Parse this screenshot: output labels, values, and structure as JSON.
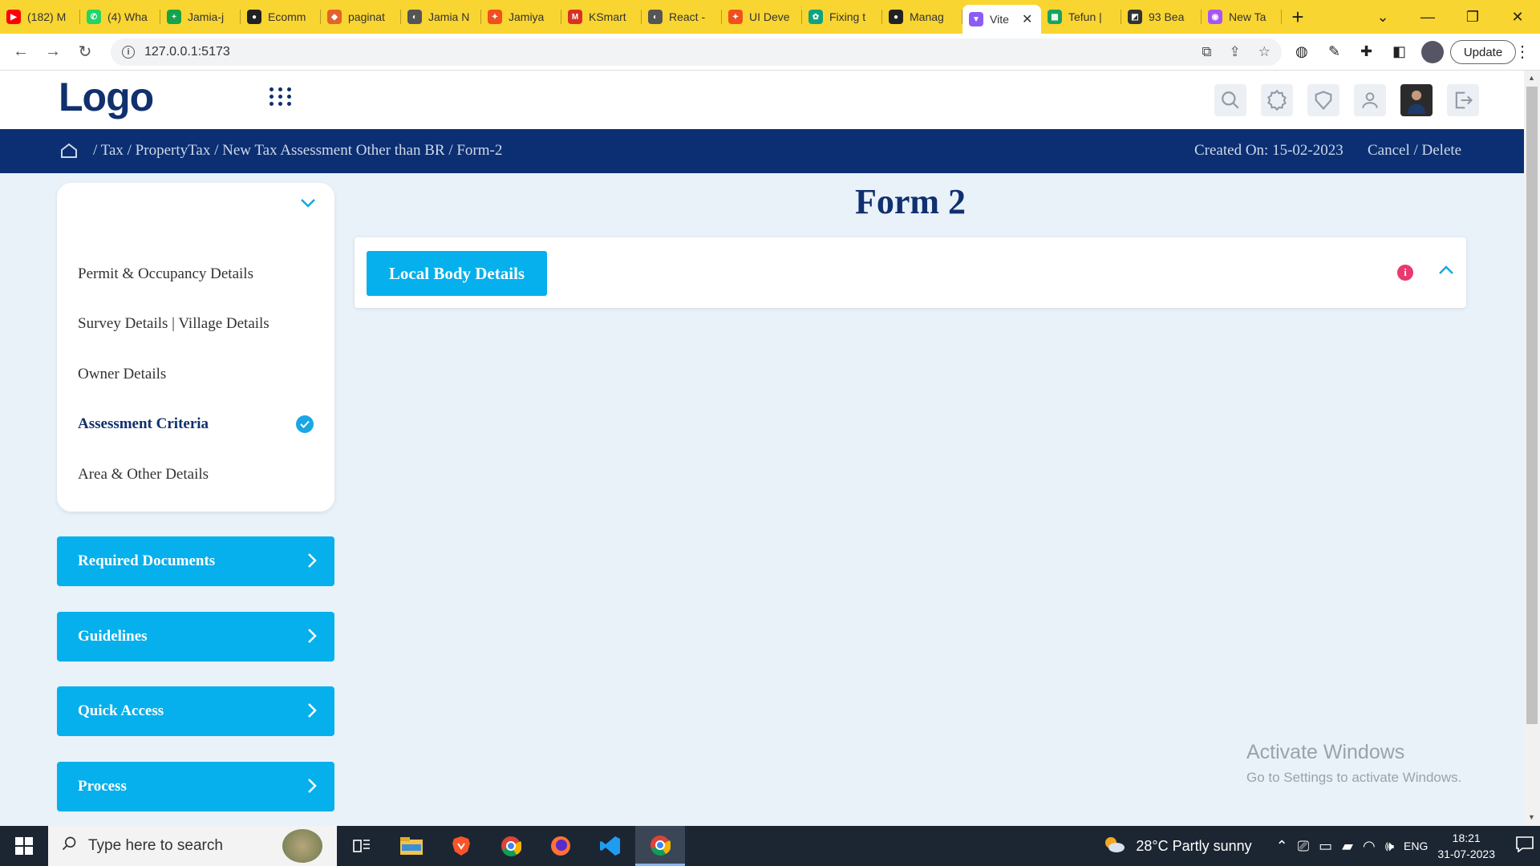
{
  "browser": {
    "tabs": [
      {
        "label": "(182) M",
        "color": "#ff0000",
        "glyph": "▶"
      },
      {
        "label": "(4) Wha",
        "color": "#25d366",
        "glyph": "✆"
      },
      {
        "label": "Jamia-j",
        "color": "#16a34a",
        "glyph": "+"
      },
      {
        "label": "Ecomm",
        "color": "#222222",
        "glyph": "●"
      },
      {
        "label": "paginat",
        "color": "#e2632d",
        "glyph": "◆"
      },
      {
        "label": "Jamia N",
        "color": "#555555",
        "glyph": "◐"
      },
      {
        "label": "Jamiya",
        "color": "#f24e1e",
        "glyph": "✦"
      },
      {
        "label": "KSmart",
        "color": "#d93025",
        "glyph": "M"
      },
      {
        "label": "React -",
        "color": "#555555",
        "glyph": "◐"
      },
      {
        "label": "UI Deve",
        "color": "#f24e1e",
        "glyph": "✦"
      },
      {
        "label": "Fixing t",
        "color": "#10a37f",
        "glyph": "✿"
      },
      {
        "label": "Manag",
        "color": "#222222",
        "glyph": "●"
      },
      {
        "label": "Vite",
        "color": "#8b5cf6",
        "glyph": "▼",
        "active": true
      },
      {
        "label": "Tefun |",
        "color": "#1aa260",
        "glyph": "▦"
      },
      {
        "label": "93 Bea",
        "color": "#333333",
        "glyph": "◩"
      },
      {
        "label": "New Ta",
        "color": "#a855f7",
        "glyph": "◉"
      }
    ],
    "url": "127.0.0.1:5173",
    "update_label": "Update"
  },
  "header": {
    "logo": "Logo"
  },
  "breadcrumb": {
    "path": "/ Tax / PropertyTax / New Tax Assessment Other than BR / Form-2",
    "created": "Created On: 15-02-2023",
    "actions": "Cancel / Delete"
  },
  "sidebar": {
    "items": [
      {
        "label": "Permit & Occupancy Details"
      },
      {
        "label": "Survey Details | Village Details"
      },
      {
        "label": "Owner Details"
      },
      {
        "label": "Assessment Criteria",
        "active": true
      },
      {
        "label": "Area & Other Details"
      }
    ],
    "buttons": [
      {
        "label": "Required Documents"
      },
      {
        "label": "Guidelines"
      },
      {
        "label": "Quick Access"
      },
      {
        "label": "Process"
      }
    ]
  },
  "main": {
    "title": "Form 2",
    "panel_label": "Local Body Details",
    "info_glyph": "i"
  },
  "watermark": {
    "line1": "Activate Windows",
    "line2": "Go to Settings to activate Windows."
  },
  "taskbar": {
    "search_placeholder": "Type here to search",
    "weather": "28°C  Partly sunny",
    "lang": "ENG",
    "time": "18:21",
    "date": "31-07-2023"
  },
  "colors": {
    "navy": "#10306e",
    "breadcrumb_bg": "#0b2f72",
    "accent_blue": "#05b0ec",
    "tab_strip": "#f9d531",
    "info_pink": "#e83a6f"
  }
}
